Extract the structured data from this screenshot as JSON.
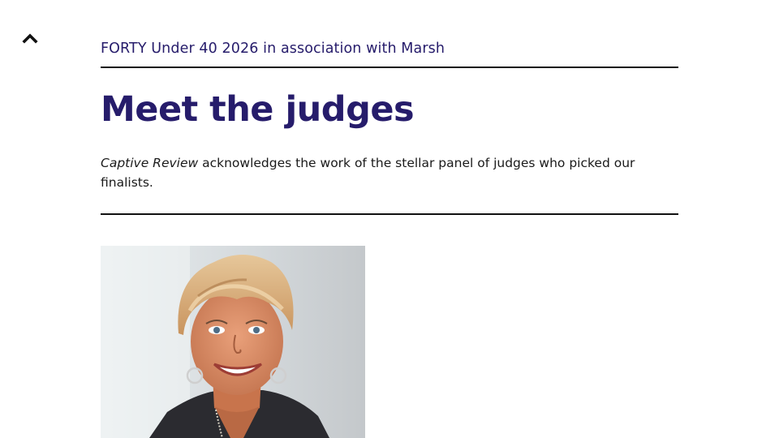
{
  "header": {
    "eyebrow": "FORTY Under 40 2026 in association with Marsh"
  },
  "main": {
    "title": "Meet the judges",
    "intro_publication": "Captive Review",
    "intro_text": " acknowledges the work of the stellar panel of judges who picked our finalists."
  },
  "colors": {
    "brand_navy": "#261c6b",
    "text": "#1a1a1a",
    "rule": "#111111"
  },
  "icons": {
    "back_to_top": "chevron-up-icon"
  },
  "judge_photo": {
    "description": "portrait-photo"
  }
}
